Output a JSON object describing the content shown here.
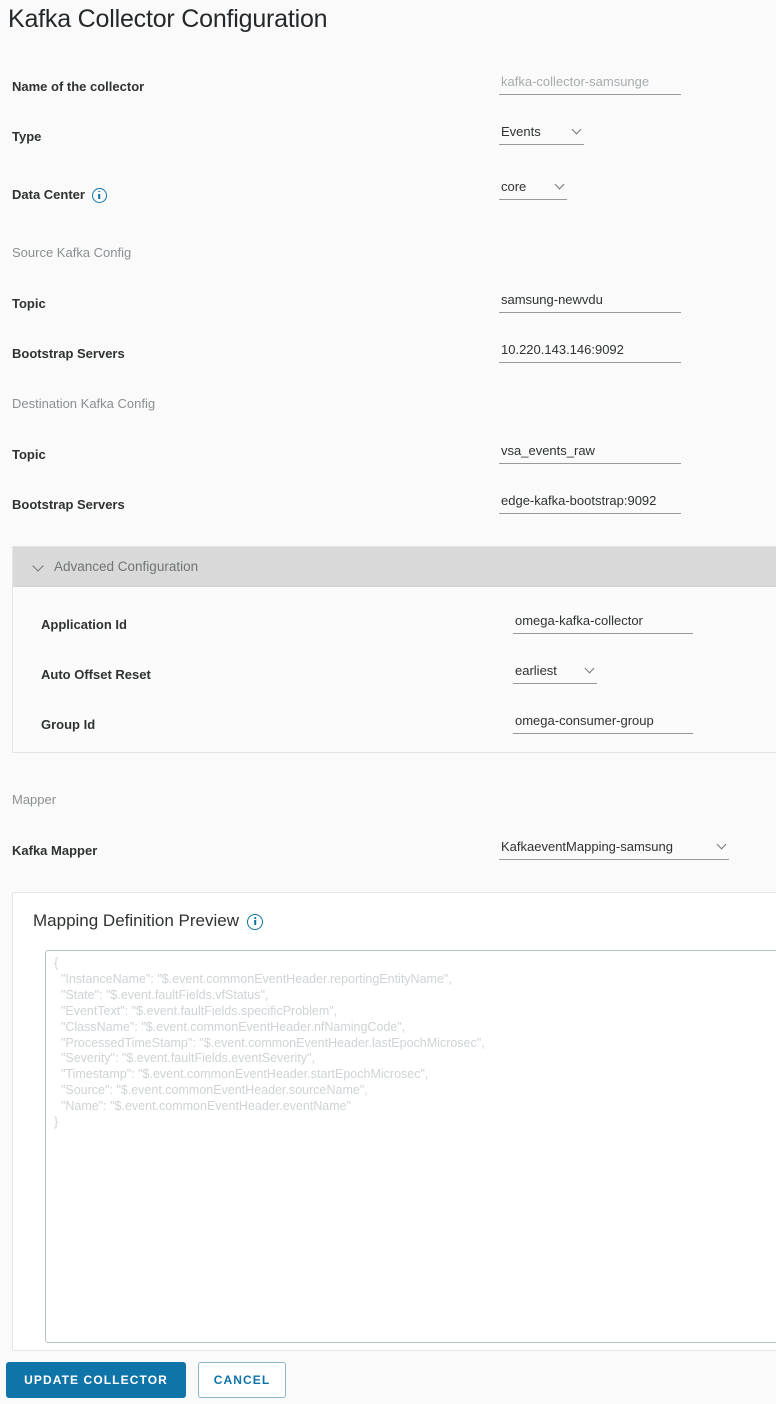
{
  "page": {
    "title": "Kafka Collector Configuration"
  },
  "fields": {
    "collector_name": {
      "label": "Name of the collector",
      "value": "kafka-collector-samsunge"
    },
    "type": {
      "label": "Type",
      "value": "Events"
    },
    "data_center": {
      "label": "Data Center",
      "value": "core",
      "info_icon": "info-icon"
    }
  },
  "source_section": {
    "heading": "Source Kafka Config",
    "topic": {
      "label": "Topic",
      "value": "samsung-newvdu"
    },
    "bootstrap": {
      "label": "Bootstrap Servers",
      "value": "10.220.143.146:9092"
    }
  },
  "destination_section": {
    "heading": "Destination Kafka Config",
    "topic": {
      "label": "Topic",
      "value": "vsa_events_raw"
    },
    "bootstrap": {
      "label": "Bootstrap Servers",
      "value": "edge-kafka-bootstrap:9092"
    }
  },
  "advanced": {
    "header": "Advanced Configuration",
    "chevron_icon": "chevron-down-icon",
    "application_id": {
      "label": "Application Id",
      "value": "omega-kafka-collector"
    },
    "auto_offset_reset": {
      "label": "Auto Offset Reset",
      "value": "earliest"
    },
    "group_id": {
      "label": "Group Id",
      "value": "omega-consumer-group"
    }
  },
  "mapper": {
    "heading": "Mapper",
    "kafka_mapper": {
      "label": "Kafka Mapper",
      "value": "KafkaeventMapping-samsung"
    }
  },
  "preview": {
    "title": "Mapping Definition Preview",
    "info_icon": "info-icon",
    "content": "{\n  \"InstanceName\": \"$.event.commonEventHeader.reportingEntityName\",\n  \"State\": \"$.event.faultFields.vfStatus\",\n  \"EventText\": \"$.event.faultFields.specificProblem\",\n  \"ClassName\": \"$.event.commonEventHeader.nfNamingCode\",\n  \"ProcessedTimeStamp\": \"$.event.commonEventHeader.lastEpochMicrosec\",\n  \"Severity\": \"$.event.faultFields.eventSeverity\",\n  \"Timestamp\": \"$.event.commonEventHeader.startEpochMicrosec\",\n  \"Source\": \"$.event.commonEventHeader.sourceName\",\n  \"Name\": \"$.event.commonEventHeader.eventName\"\n}"
  },
  "actions": {
    "update": "UPDATE COLLECTOR",
    "cancel": "CANCEL"
  },
  "colors": {
    "accent": "#0f74a8",
    "page_background": "#fafafa",
    "advanced_header": "#d9d9d9",
    "label_text": "#2f3233",
    "muted_text": "#8a8f91",
    "placeholder_text": "#cfd3d5"
  }
}
